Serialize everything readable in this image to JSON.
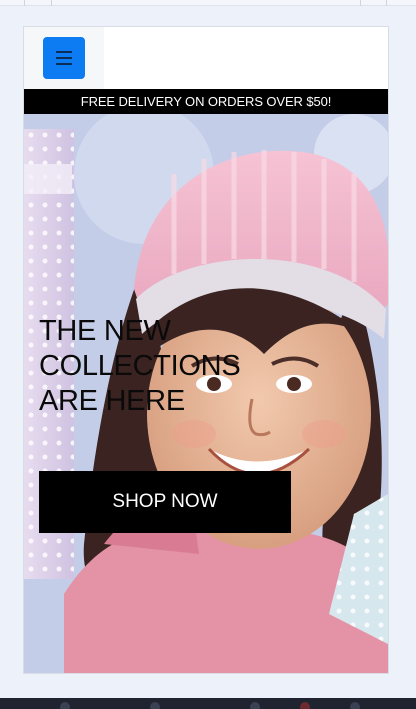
{
  "promo": {
    "text": "FREE DELIVERY ON ORDERS OVER $50!"
  },
  "hero": {
    "title_lines": [
      "THE NEW",
      "COLLECTIONS",
      "ARE HERE"
    ],
    "cta_label": "SHOP NOW"
  },
  "header": {
    "menu_icon": "hamburger-menu-icon"
  },
  "colors": {
    "menu_button": "#0d7bf2",
    "promo_background": "#000000",
    "cta_background": "#000000",
    "page_background": "#edf1f9"
  }
}
